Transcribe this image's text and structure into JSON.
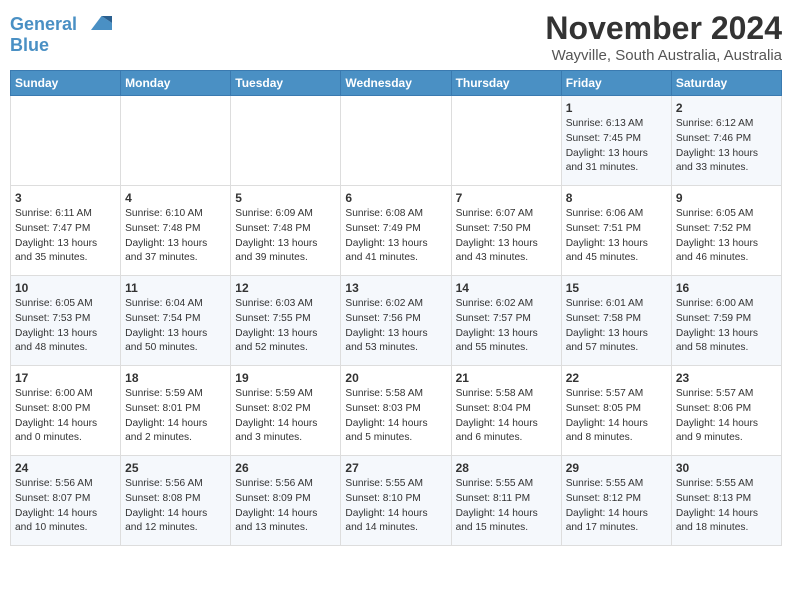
{
  "header": {
    "logo_line1": "General",
    "logo_line2": "Blue",
    "title": "November 2024",
    "subtitle": "Wayville, South Australia, Australia"
  },
  "days_of_week": [
    "Sunday",
    "Monday",
    "Tuesday",
    "Wednesday",
    "Thursday",
    "Friday",
    "Saturday"
  ],
  "weeks": [
    [
      {
        "day": "",
        "info": ""
      },
      {
        "day": "",
        "info": ""
      },
      {
        "day": "",
        "info": ""
      },
      {
        "day": "",
        "info": ""
      },
      {
        "day": "",
        "info": ""
      },
      {
        "day": "1",
        "info": "Sunrise: 6:13 AM\nSunset: 7:45 PM\nDaylight: 13 hours and 31 minutes."
      },
      {
        "day": "2",
        "info": "Sunrise: 6:12 AM\nSunset: 7:46 PM\nDaylight: 13 hours and 33 minutes."
      }
    ],
    [
      {
        "day": "3",
        "info": "Sunrise: 6:11 AM\nSunset: 7:47 PM\nDaylight: 13 hours and 35 minutes."
      },
      {
        "day": "4",
        "info": "Sunrise: 6:10 AM\nSunset: 7:48 PM\nDaylight: 13 hours and 37 minutes."
      },
      {
        "day": "5",
        "info": "Sunrise: 6:09 AM\nSunset: 7:48 PM\nDaylight: 13 hours and 39 minutes."
      },
      {
        "day": "6",
        "info": "Sunrise: 6:08 AM\nSunset: 7:49 PM\nDaylight: 13 hours and 41 minutes."
      },
      {
        "day": "7",
        "info": "Sunrise: 6:07 AM\nSunset: 7:50 PM\nDaylight: 13 hours and 43 minutes."
      },
      {
        "day": "8",
        "info": "Sunrise: 6:06 AM\nSunset: 7:51 PM\nDaylight: 13 hours and 45 minutes."
      },
      {
        "day": "9",
        "info": "Sunrise: 6:05 AM\nSunset: 7:52 PM\nDaylight: 13 hours and 46 minutes."
      }
    ],
    [
      {
        "day": "10",
        "info": "Sunrise: 6:05 AM\nSunset: 7:53 PM\nDaylight: 13 hours and 48 minutes."
      },
      {
        "day": "11",
        "info": "Sunrise: 6:04 AM\nSunset: 7:54 PM\nDaylight: 13 hours and 50 minutes."
      },
      {
        "day": "12",
        "info": "Sunrise: 6:03 AM\nSunset: 7:55 PM\nDaylight: 13 hours and 52 minutes."
      },
      {
        "day": "13",
        "info": "Sunrise: 6:02 AM\nSunset: 7:56 PM\nDaylight: 13 hours and 53 minutes."
      },
      {
        "day": "14",
        "info": "Sunrise: 6:02 AM\nSunset: 7:57 PM\nDaylight: 13 hours and 55 minutes."
      },
      {
        "day": "15",
        "info": "Sunrise: 6:01 AM\nSunset: 7:58 PM\nDaylight: 13 hours and 57 minutes."
      },
      {
        "day": "16",
        "info": "Sunrise: 6:00 AM\nSunset: 7:59 PM\nDaylight: 13 hours and 58 minutes."
      }
    ],
    [
      {
        "day": "17",
        "info": "Sunrise: 6:00 AM\nSunset: 8:00 PM\nDaylight: 14 hours and 0 minutes."
      },
      {
        "day": "18",
        "info": "Sunrise: 5:59 AM\nSunset: 8:01 PM\nDaylight: 14 hours and 2 minutes."
      },
      {
        "day": "19",
        "info": "Sunrise: 5:59 AM\nSunset: 8:02 PM\nDaylight: 14 hours and 3 minutes."
      },
      {
        "day": "20",
        "info": "Sunrise: 5:58 AM\nSunset: 8:03 PM\nDaylight: 14 hours and 5 minutes."
      },
      {
        "day": "21",
        "info": "Sunrise: 5:58 AM\nSunset: 8:04 PM\nDaylight: 14 hours and 6 minutes."
      },
      {
        "day": "22",
        "info": "Sunrise: 5:57 AM\nSunset: 8:05 PM\nDaylight: 14 hours and 8 minutes."
      },
      {
        "day": "23",
        "info": "Sunrise: 5:57 AM\nSunset: 8:06 PM\nDaylight: 14 hours and 9 minutes."
      }
    ],
    [
      {
        "day": "24",
        "info": "Sunrise: 5:56 AM\nSunset: 8:07 PM\nDaylight: 14 hours and 10 minutes."
      },
      {
        "day": "25",
        "info": "Sunrise: 5:56 AM\nSunset: 8:08 PM\nDaylight: 14 hours and 12 minutes."
      },
      {
        "day": "26",
        "info": "Sunrise: 5:56 AM\nSunset: 8:09 PM\nDaylight: 14 hours and 13 minutes."
      },
      {
        "day": "27",
        "info": "Sunrise: 5:55 AM\nSunset: 8:10 PM\nDaylight: 14 hours and 14 minutes."
      },
      {
        "day": "28",
        "info": "Sunrise: 5:55 AM\nSunset: 8:11 PM\nDaylight: 14 hours and 15 minutes."
      },
      {
        "day": "29",
        "info": "Sunrise: 5:55 AM\nSunset: 8:12 PM\nDaylight: 14 hours and 17 minutes."
      },
      {
        "day": "30",
        "info": "Sunrise: 5:55 AM\nSunset: 8:13 PM\nDaylight: 14 hours and 18 minutes."
      }
    ]
  ]
}
